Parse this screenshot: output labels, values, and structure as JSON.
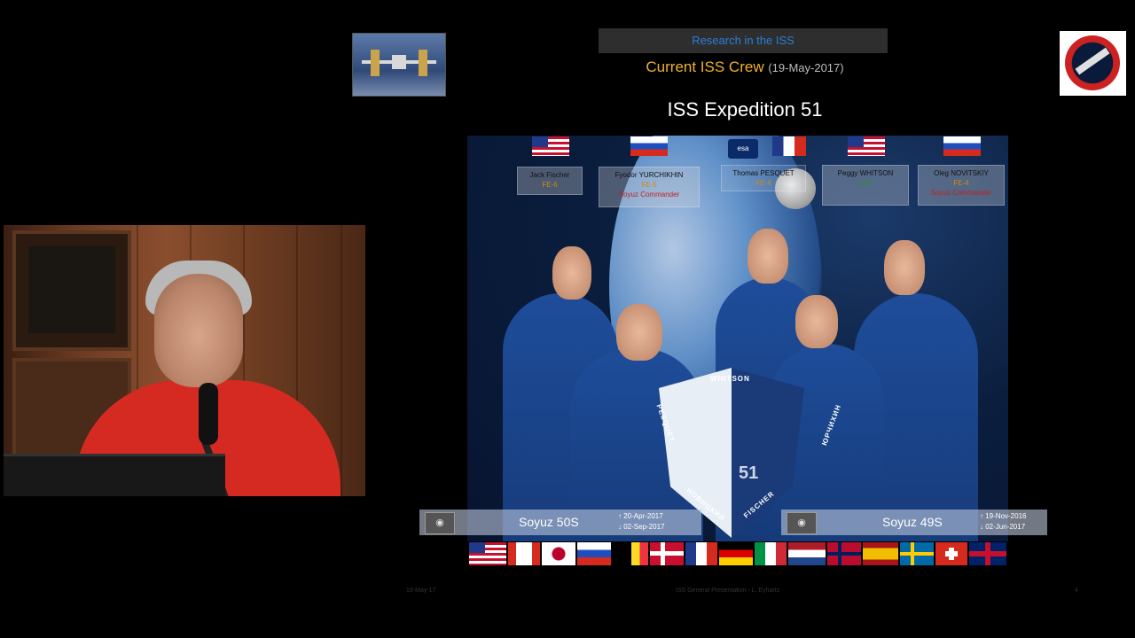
{
  "header": {
    "research_label": "Research in the ISS",
    "crew_title": "Current ISS Crew",
    "crew_date": "(19-May-2017)",
    "expedition_title": "ISS Expedition 51"
  },
  "crew": [
    {
      "name": "Jack Fischer",
      "role": "FE-6",
      "ship": "",
      "role_color": "orange"
    },
    {
      "name": "Fyodor YURCHIKHIN",
      "role": "FE-5",
      "ship": "Soyuz Commander",
      "role_color": "orange"
    },
    {
      "name": "Thomas PESQUET",
      "role": "FE-4",
      "ship": "",
      "role_color": "orange"
    },
    {
      "name": "Peggy WHITSON",
      "role": "CDR",
      "ship": "",
      "role_color": "green"
    },
    {
      "name": "Oleg NOVITSKIY",
      "role": "FE-4",
      "ship": "Soyuz Commander",
      "role_color": "orange"
    }
  ],
  "agency_logo": "esa",
  "patch": {
    "number": "51",
    "names": [
      "WHITSON",
      "PESQUET",
      "НОВИЦКИЙ",
      "FISCHER",
      "ЮРЧИХИН"
    ]
  },
  "soyuz": [
    {
      "name": "Soyuz 50S",
      "launch": "↑ 20-Apr-2017",
      "landing": "↓ 02-Sep-2017"
    },
    {
      "name": "Soyuz 49S",
      "launch": "↑ 19-Nov-2016",
      "landing": "↓ 02-Jun-2017"
    }
  ],
  "footer": {
    "date": "19-May-17",
    "center": "ISS General Presentation - L. Eyharts",
    "page": "4"
  },
  "colors": {
    "title_orange": "#f0b030",
    "research_blue": "#2c7fd6",
    "shirt_red": "#d42a22"
  }
}
